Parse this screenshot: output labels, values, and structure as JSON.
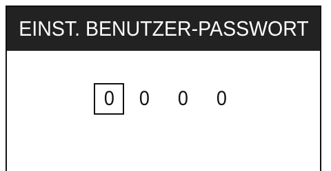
{
  "screen": {
    "title": "EINST. BENUTZER-PASSWORT"
  },
  "password": {
    "digits": [
      "0",
      "0",
      "0",
      "0"
    ],
    "selected_index": 0
  },
  "colors": {
    "title_background": "#222222",
    "title_text": "#ffffff",
    "foreground": "#111111",
    "background": "#ffffff"
  }
}
